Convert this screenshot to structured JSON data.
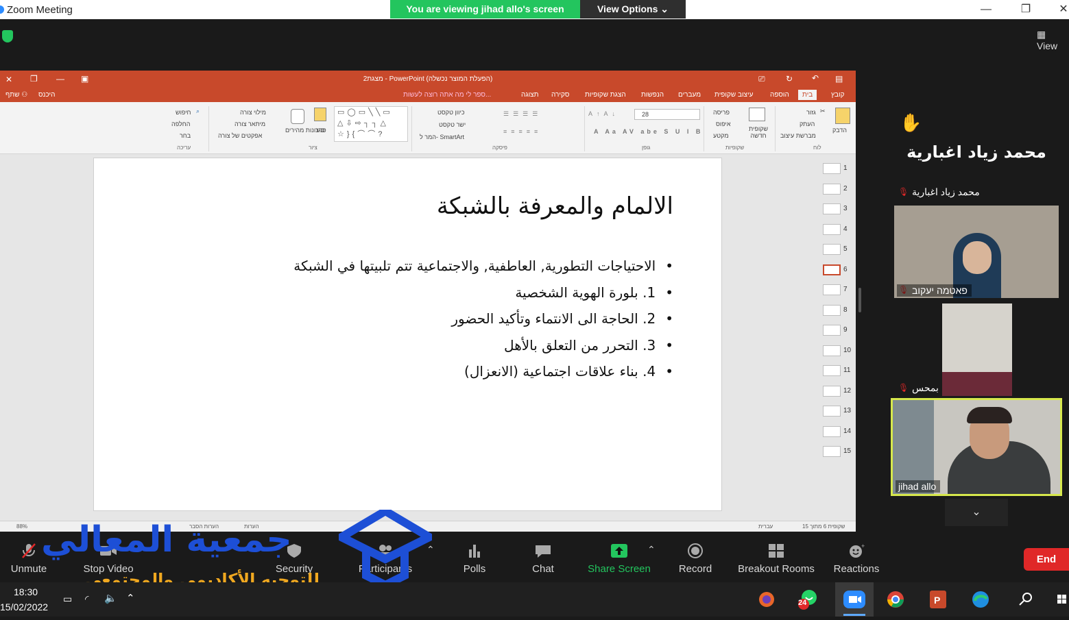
{
  "zoom": {
    "window_title": "Zoom Meeting",
    "share_banner": "You are viewing jihad allo's screen",
    "view_options": "View Options",
    "view_button": "View",
    "end_button": "End",
    "toolbar": {
      "unmute": "Unmute",
      "stop_video": "Stop Video",
      "security": "Security",
      "participants": "Participants",
      "polls": "Polls",
      "chat": "Chat",
      "share_screen": "Share Screen",
      "record": "Record",
      "breakout_rooms": "Breakout Rooms",
      "reactions": "Reactions"
    },
    "participants": [
      {
        "name": "محمد زياد اغبارية",
        "large_name": "محمد زياد اغبارية",
        "raised_hand": true
      },
      {
        "name": "פאטמה יעקוב"
      },
      {
        "name": "بمحس"
      },
      {
        "name": "jihad allo",
        "active_speaker": true
      }
    ]
  },
  "powerpoint": {
    "title": "מצגת2 - PowerPoint (הפעלת המוצר נכשלה)",
    "tabs": [
      "קובץ",
      "בית",
      "הוספה",
      "עיצוב שקופית",
      "מעברים",
      "הנפשות",
      "הצגת שקופיות",
      "סקירה",
      "תצוגה"
    ],
    "tell_me": "ספר לי מה אתה רוצה לעשות...",
    "share": "שתף",
    "signin": "היכנס",
    "ribbon": {
      "clipboard": "לוח",
      "slides": "שקופיות",
      "font": "גופן",
      "paragraph": "פיסקה",
      "drawing": "ציור",
      "editing": "עריכה",
      "paste": "הדבק",
      "cut": "גזור",
      "copy": "העתק",
      "format_painter": "מברשת עיצוב",
      "new_slide": "שקופית חדשה",
      "layout": "פריסה",
      "reset": "איפוס",
      "section": "מקטע",
      "font_size": "28",
      "text_direction": "כיוון טקסט",
      "align_text": "ישר טקסט",
      "smartart": "המר ל- SmartArt",
      "arrange": "סדר",
      "quick_styles": "סגנונות מהירים",
      "shape_fill": "מילוי צורה",
      "shape_outline": "מיתאר צורה",
      "shape_effects": "אפקטים של צורה",
      "find": "חיפוש",
      "replace": "החלפה",
      "select": "בחר"
    },
    "slide": {
      "title": "الالمام والمعرفة بالشبكة",
      "bullets": [
        "الاحتياجات التطورية, العاطفية, والاجتماعية تتم تلبيتها في الشبكة",
        "1. بلورة الهوية الشخصية",
        "2. الحاجة الى الانتماء وتأكيد الحضور",
        "3. التحرر من التعلق بالأهل",
        "4. بناء علاقات اجتماعية (الانعزال)"
      ]
    },
    "thumbnails": [
      "1",
      "2",
      "3",
      "4",
      "5",
      "6",
      "7",
      "8",
      "9",
      "10",
      "11",
      "12",
      "13",
      "14",
      "15"
    ],
    "selected_slide": 6,
    "status": {
      "slide_info": "שקופית 6 מתוך 15",
      "language": "עברית",
      "notes": "הערות",
      "comments": "הערות הסבר",
      "zoom": "88%"
    }
  },
  "watermark": {
    "main": "جمعية المعالي",
    "sub": "للتوجيه الأكاديمي والمجتمعي"
  },
  "taskbar": {
    "time": "18:30",
    "date": "15/02/2022",
    "whatsapp_badge": "24"
  }
}
